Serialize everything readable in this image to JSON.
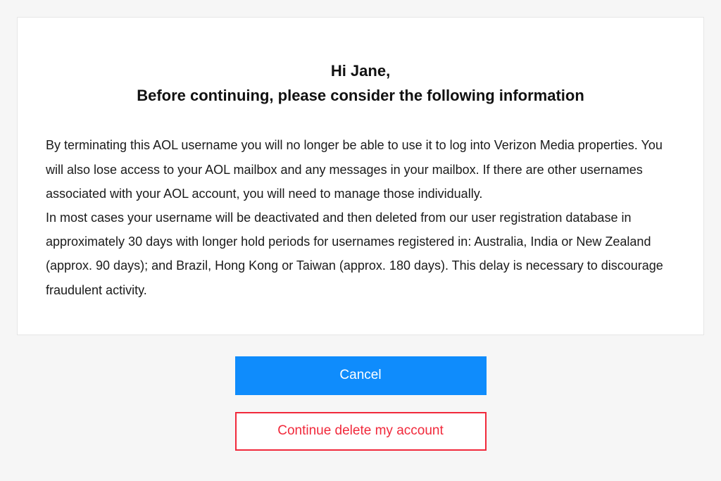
{
  "heading": {
    "greeting": "Hi Jane,",
    "subtitle": "Before continuing, please consider the following information"
  },
  "body": {
    "para1": "By terminating this AOL username you will no longer be able to use it to log into Verizon Media properties. You will also lose access to your AOL mailbox and any messages in your mailbox. If there are other usernames associated with your AOL account, you will need to manage those individually.",
    "para2": "In most cases your username will be deactivated and then deleted from our user registration database in approximately 30 days with longer hold periods for usernames registered in: Australia, India or New Zealand (approx. 90 days); and Brazil, Hong Kong or Taiwan (approx. 180 days). This delay is necessary to discourage fraudulent activity."
  },
  "buttons": {
    "cancel": "Cancel",
    "continue": "Continue delete my account"
  }
}
